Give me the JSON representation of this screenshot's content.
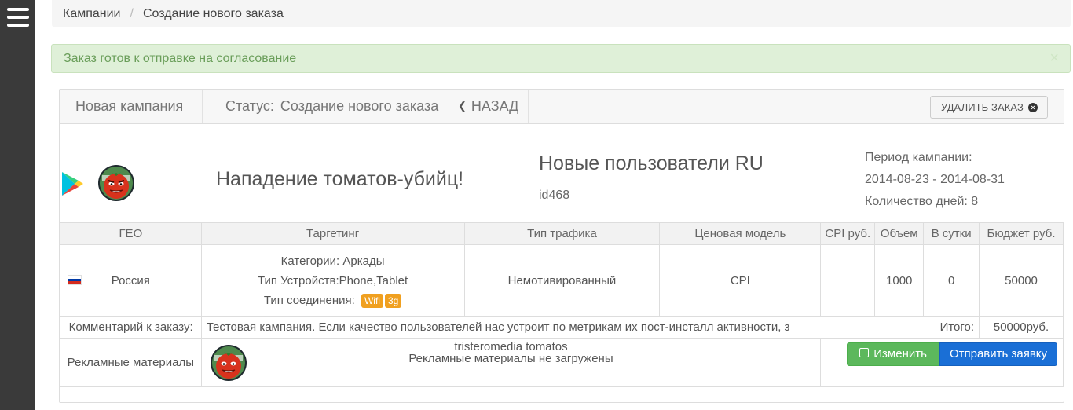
{
  "sidebar": {
    "menu_icon": "hamburger-menu-icon"
  },
  "breadcrumb": {
    "parent": "Кампании",
    "separator": "/",
    "current": "Создание нового заказа"
  },
  "alert": {
    "message": "Заказ готов к отправке на согласование",
    "close": "×"
  },
  "toolbar": {
    "campaign_name": "Новая кампания",
    "status_label": "Статус:",
    "status_value": "Создание нового заказа",
    "back_label": "НАЗАД",
    "delete_label": "УДАЛИТЬ ЗАКАЗ",
    "delete_icon": "×"
  },
  "app": {
    "title": "Нападение томатов-убийц!",
    "store_icon": "google-play-icon",
    "app_icon": "tomato-app-icon"
  },
  "offer": {
    "title": "Новые пользователи RU",
    "id": "id468"
  },
  "period": {
    "label": "Период кампании:",
    "range": "2014-08-23 - 2014-08-31",
    "days": "Количество дней: 8"
  },
  "table": {
    "headers": {
      "geo": "ГЕО",
      "targeting": "Таргетинг",
      "traffic": "Тип трафика",
      "pricing": "Ценовая модель",
      "cpi": "CPI руб.",
      "volume": "Объем",
      "per_day": "В сутки",
      "budget": "Бюджет руб."
    },
    "row": {
      "country": "Россия",
      "categories": "Категории: Аркады",
      "devices": "Тип Устройств:Phone,Tablet",
      "connection_label": "Тип соединения:",
      "connection_badges": [
        "Wifi",
        "3g"
      ],
      "traffic": "Немотивированный",
      "pricing": "CPI",
      "cpi": "",
      "volume": "1000",
      "per_day": "0",
      "budget": "50000"
    },
    "comment_label": "Комментарий к заказу:",
    "comment_text": "Тестовая кампания. Если качество пользователей нас устроит по метрикам их пост-инсталл активности, з",
    "total_label": "Итого:",
    "total_value": "50000руб.",
    "materials_label": "Рекламные материалы",
    "materials_name": "tristeromedia tomatos",
    "materials_status": "Рекламные материалы не загружены",
    "edit_label": "Изменить",
    "send_label": "Отправить заявку"
  },
  "colors": {
    "sidebar": "#3a3a3a",
    "alert_bg": "#dff0d8",
    "alert_text": "#6a9e5a",
    "badge": "#f0a020",
    "btn_edit": "#5cb85c",
    "btn_send": "#1a6fd6"
  }
}
